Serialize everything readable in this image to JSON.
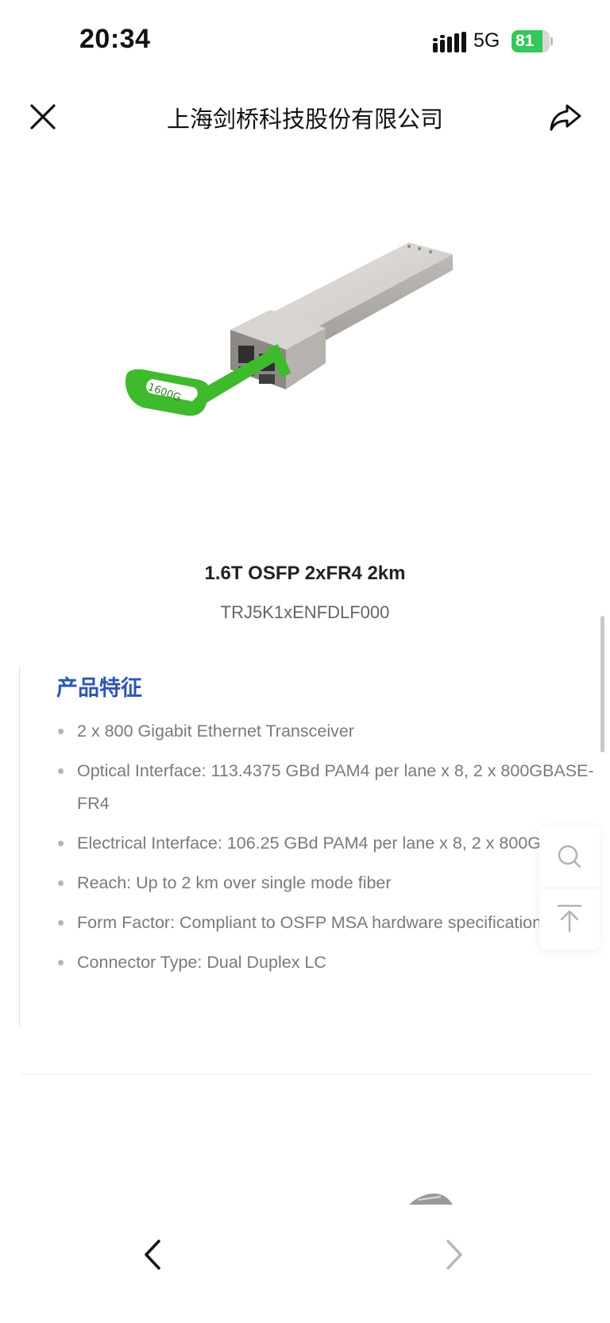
{
  "status_bar": {
    "time": "20:34",
    "network": "5G",
    "battery": "81",
    "battery_level": 0.81,
    "battery_color": "#34c759"
  },
  "nav": {
    "title": "上海剑桥科技股份有限公司",
    "close_icon": "close-icon",
    "share_icon": "share-arrow-icon"
  },
  "product": {
    "image_label": "1600G",
    "name": "1.6T OSFP 2xFR4 2km",
    "code": "TRJ5K1xENFDLF000"
  },
  "features": {
    "title": "产品特征",
    "accent_color": "#2d56b3",
    "items": [
      "2 x 800 Gigabit Ethernet Transceiver",
      "Optical Interface: 113.4375 GBd PAM4 per lane x 8, 2 x 800GBASE-FR4",
      "Electrical Interface: 106.25 GBd PAM4 per lane x 8, 2 x 800GAUI-4",
      "Reach: Up to 2 km over single mode fiber",
      "Form Factor: Compliant to OSFP MSA hardware specification",
      "Connector Type: Dual Duplex LC"
    ]
  },
  "floating_actions": {
    "search_icon": "search-icon",
    "back_to_top_icon": "back-to-top-icon"
  },
  "bottom_nav": {
    "back_icon": "chevron-left-icon",
    "forward_icon": "chevron-right-icon",
    "forward_enabled": false
  }
}
